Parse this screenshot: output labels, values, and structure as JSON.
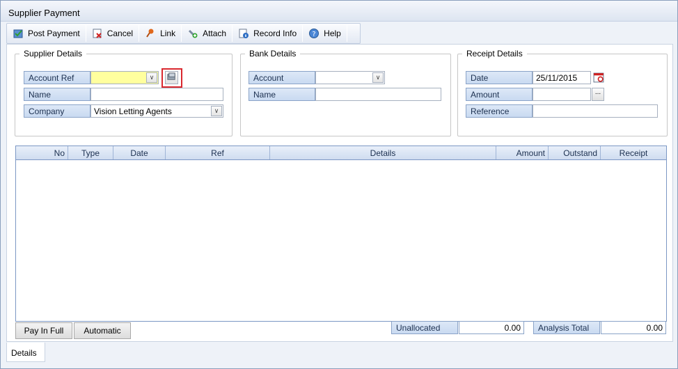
{
  "window": {
    "title": "Supplier Payment"
  },
  "toolbar": {
    "post_payment": "Post Payment",
    "cancel": "Cancel",
    "link": "Link",
    "attach": "Attach",
    "record_info": "Record Info",
    "help": "Help"
  },
  "supplier": {
    "legend": "Supplier Details",
    "account_ref_label": "Account Ref",
    "account_ref_value": "",
    "name_label": "Name",
    "name_value": "",
    "company_label": "Company",
    "company_value": "Vision Letting Agents"
  },
  "bank": {
    "legend": "Bank Details",
    "account_label": "Account",
    "account_value": "",
    "name_label": "Name",
    "name_value": ""
  },
  "receipt": {
    "legend": "Receipt Details",
    "date_label": "Date",
    "date_value": "25/11/2015",
    "amount_label": "Amount",
    "amount_value": "",
    "reference_label": "Reference",
    "reference_value": ""
  },
  "grid": {
    "columns": [
      "No",
      "Type",
      "Date",
      "Ref",
      "Details",
      "Amount",
      "Outstand",
      "Receipt"
    ]
  },
  "footer": {
    "pay_in_full": "Pay In Full",
    "automatic": "Automatic",
    "unallocated_label": "Unallocated",
    "unallocated_value": "0.00",
    "analysis_total_label": "Analysis Total",
    "analysis_total_value": "0.00"
  },
  "tabs": {
    "details": "Details"
  },
  "icons": {
    "post_payment": "post-payment-icon",
    "cancel": "cancel-icon",
    "link": "link-icon",
    "attach": "attach-icon",
    "record_info": "record-info-icon",
    "help": "help-icon",
    "lookup": "lookup-icon",
    "calendar": "calendar-icon"
  },
  "colors": {
    "highlight_border": "#d9282f",
    "required_field": "#ffff9e"
  }
}
